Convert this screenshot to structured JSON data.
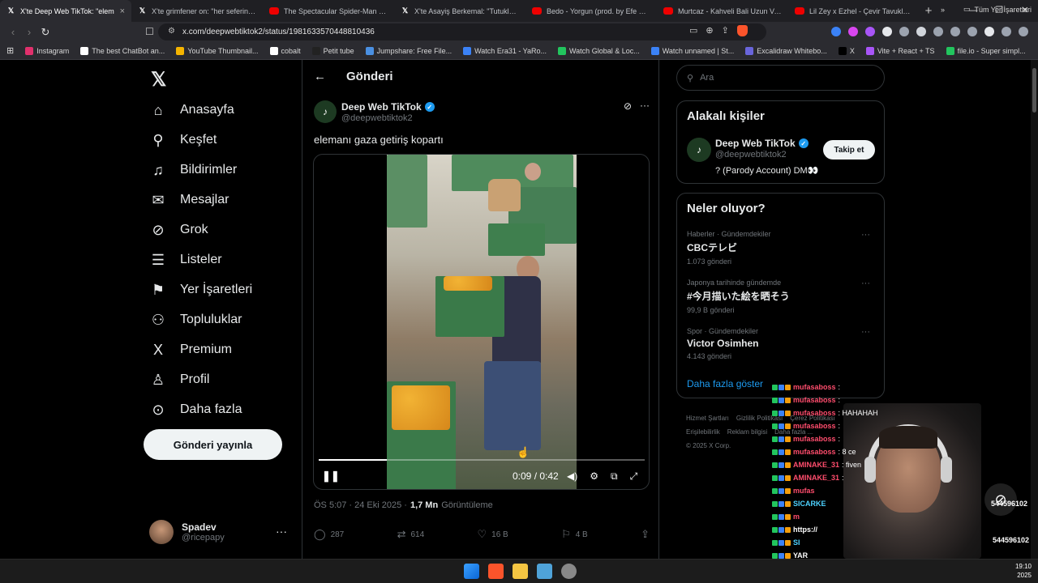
{
  "browser": {
    "tabs": [
      {
        "icon": "x-icon",
        "title": "X'te Deep Web TikTok: \"elem"
      },
      {
        "icon": "x-icon",
        "title": "X'te grimfener on: \"her seferinde yan"
      },
      {
        "icon": "youtube-icon",
        "title": "The Spectacular Spider-Man Music V"
      },
      {
        "icon": "x-icon",
        "title": "X'te Asayiş Berkemal: \"Tutuklanan şa"
      },
      {
        "icon": "youtube-icon",
        "title": "Bedo - Yorgun (prod. by Efe Can) - Yo"
      },
      {
        "icon": "youtube-icon",
        "title": "Murtcaz - Kahveli Bali Uzun Versiyon"
      },
      {
        "icon": "youtube-icon",
        "title": "Lil Zey x Ezhel - Çevir Tavukları (Offic"
      }
    ],
    "new_tab": "+",
    "window": {
      "minimize": "—",
      "maximize": "❐",
      "close": "✕"
    },
    "url": "x.com/deepwebtiktok2/status/1981633570448810436",
    "bookmarks": [
      {
        "label": "Instagram",
        "color": "#e1306c"
      },
      {
        "label": "The best ChatBot an...",
        "color": "#ffffff"
      },
      {
        "label": "YouTube Thumbnail...",
        "color": "#f5b400"
      },
      {
        "label": "cobalt",
        "color": "#ffffff"
      },
      {
        "label": "Petit tube",
        "color": "#222222"
      },
      {
        "label": "Jumpshare: Free File...",
        "color": "#4a90e2"
      },
      {
        "label": "Watch Era31 - YaRo...",
        "color": "#3b82f6"
      },
      {
        "label": "Watch Global & Loc...",
        "color": "#22c55e"
      },
      {
        "label": "Watch unnamed | St...",
        "color": "#3b82f6"
      },
      {
        "label": "Excalidraw Whitebo...",
        "color": "#6965db"
      },
      {
        "label": "X",
        "color": "#000000"
      },
      {
        "label": "Vite + React + TS",
        "color": "#a855f7"
      },
      {
        "label": "file.io - Super simpl...",
        "color": "#22c55e"
      }
    ],
    "other_bookmarks": "Tüm Yer İşaretleri"
  },
  "nav": {
    "items": [
      {
        "label": "Anasayfa",
        "icon": "home-icon",
        "glyph": "⌂"
      },
      {
        "label": "Keşfet",
        "icon": "search-icon",
        "glyph": "⚲"
      },
      {
        "label": "Bildirimler",
        "icon": "bell-icon",
        "glyph": "♫"
      },
      {
        "label": "Mesajlar",
        "icon": "mail-icon",
        "glyph": "✉"
      },
      {
        "label": "Grok",
        "icon": "grok-icon",
        "glyph": "⊘"
      },
      {
        "label": "Listeler",
        "icon": "list-icon",
        "glyph": "☰"
      },
      {
        "label": "Yer İşaretleri",
        "icon": "bookmark-icon",
        "glyph": "⚑"
      },
      {
        "label": "Topluluklar",
        "icon": "communities-icon",
        "glyph": "⚇"
      },
      {
        "label": "Premium",
        "icon": "x-premium-icon",
        "glyph": "X"
      },
      {
        "label": "Profil",
        "icon": "profile-icon",
        "glyph": "♙"
      },
      {
        "label": "Daha fazla",
        "icon": "more-circle-icon",
        "glyph": "⊙"
      }
    ],
    "post_button": "Gönderi yayınla",
    "account": {
      "name": "Spadev",
      "handle": "@ricepapy"
    }
  },
  "main": {
    "title": "Gönderi",
    "post": {
      "author_name": "Deep Web TikTok",
      "author_handle": "@deepwebtiktok2",
      "text": "elemanı gaza getiriş kopartı",
      "video": {
        "time": "0:09 / 0:42",
        "progress": 0.21
      },
      "timestamp": "ÖS 5:07 · 24 Eki 2025 ·",
      "views_count": "1,7 Mn",
      "views_label": "Görüntüleme",
      "actions": {
        "replies": "287",
        "reposts": "614",
        "likes": "16 B",
        "bookmarks": "4 B"
      }
    }
  },
  "sidebar": {
    "search_placeholder": "Ara",
    "related": {
      "title": "Alakalı kişiler",
      "name": "Deep Web TikTok",
      "handle": "@deepwebtiktok2",
      "bio": "? (Parody Account) DM👀",
      "follow_label": "Takip et"
    },
    "trends": {
      "title": "Neler oluyor?",
      "items": [
        {
          "category": "Haberler · Gündemdekiler",
          "name": "CBCテレビ",
          "count": "1.073 gönderi"
        },
        {
          "category": "Japonya tarihinde gündemde",
          "name": "#今月描いた絵を晒そう",
          "count": "99,9 B gönderi"
        },
        {
          "category": "Spor · Gündemdekiler",
          "name": "Victor Osimhen",
          "count": "4.143 gönderi"
        }
      ],
      "show_more": "Daha fazla göster"
    },
    "footer": {
      "links": [
        "Hizmet Şartları",
        "Gizlilik Politikası",
        "Çerez Politikası",
        "Erişilebilirlik",
        "Reklam bilgisi",
        "Daha fazla ..."
      ],
      "copyright": "© 2025 X Corp."
    }
  },
  "stream_chat": [
    {
      "user": "mufasaboss",
      "msg": ":",
      "color": "#ff4d6d"
    },
    {
      "user": "mufasaboss",
      "msg": ":",
      "color": "#ff4d6d"
    },
    {
      "user": "mufasaboss",
      "msg": ": HAHAHAH",
      "color": "#ff4d6d"
    },
    {
      "user": "mufasaboss",
      "msg": ":",
      "color": "#ff4d6d"
    },
    {
      "user": "mufasaboss",
      "msg": ":",
      "color": "#ff4d6d"
    },
    {
      "user": "mufasaboss",
      "msg": ": 8 ce",
      "color": "#ff4d6d"
    },
    {
      "user": "AMINAKE_31",
      "msg": ": fiven",
      "color": "#ff4d6d"
    },
    {
      "user": "AMINAKE_31",
      "msg": ":",
      "color": "#ff4d6d"
    },
    {
      "user": "mufas",
      "msg": "",
      "color": "#ff4d6d"
    },
    {
      "user": "SICARKE",
      "msg": "",
      "color": "#4dd2ff"
    },
    {
      "user": "m",
      "msg": "",
      "color": "#ff4d6d"
    },
    {
      "user": "https://",
      "msg": "",
      "color": "#ffffff"
    },
    {
      "user": "SI",
      "msg": "",
      "color": "#4dd2ff"
    },
    {
      "user": "YAR",
      "msg": "",
      "color": "#ffffff"
    }
  ],
  "stream_numbers": [
    "544596102",
    "544596102"
  ],
  "taskbar": {
    "time": "19:10",
    "date": "2025"
  }
}
